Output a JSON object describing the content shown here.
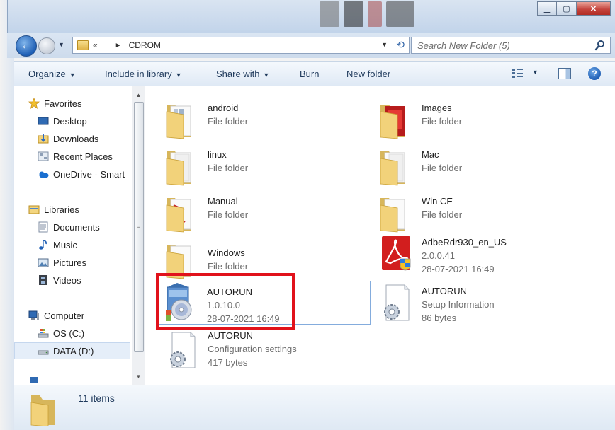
{
  "window": {
    "minimize": "▁",
    "maximize": "▢",
    "close": "✕"
  },
  "address": {
    "overflow": "«",
    "separator": "►",
    "current": "CDROM"
  },
  "search": {
    "placeholder": "Search New Folder (5)"
  },
  "toolbar": {
    "organize": "Organize",
    "include_in_library": "Include in library",
    "share_with": "Share with",
    "burn": "Burn",
    "new_folder": "New folder",
    "caret": "▼",
    "help": "?"
  },
  "nav": {
    "favorites": "Favorites",
    "desktop": "Desktop",
    "downloads": "Downloads",
    "recent_places": "Recent Places",
    "onedrive": "OneDrive - Smart",
    "libraries": "Libraries",
    "documents": "Documents",
    "music": "Music",
    "pictures": "Pictures",
    "videos": "Videos",
    "computer": "Computer",
    "os_c": "OS (C:)",
    "data_d": "DATA (D:)"
  },
  "files": [
    {
      "name": "android",
      "line2": "File folder",
      "line3": "",
      "icon": "folder-icon"
    },
    {
      "name": "Images",
      "line2": "File folder",
      "line3": "",
      "icon": "folder-icon"
    },
    {
      "name": "linux",
      "line2": "File folder",
      "line3": "",
      "icon": "folder-icon"
    },
    {
      "name": "Mac",
      "line2": "File folder",
      "line3": "",
      "icon": "folder-icon"
    },
    {
      "name": "Manual",
      "line2": "File folder",
      "line3": "",
      "icon": "folder-icon"
    },
    {
      "name": "Win CE",
      "line2": "File folder",
      "line3": "",
      "icon": "folder-icon"
    },
    {
      "name": "Windows",
      "line2": "File folder",
      "line3": "",
      "icon": "folder-icon"
    },
    {
      "name": "AdbeRdr930_en_US",
      "line2": "2.0.0.41",
      "line3": "28-07-2021 16:49",
      "icon": "adobe-reader-installer-icon"
    },
    {
      "name": "AUTORUN",
      "line2": "1.0.10.0",
      "line3": "28-07-2021 16:49",
      "icon": "autorun-exe-icon"
    },
    {
      "name": "AUTORUN",
      "line2": "Setup Information",
      "line3": "86 bytes",
      "icon": "setup-information-icon"
    },
    {
      "name": "AUTORUN",
      "line2": "Configuration settings",
      "line3": "417 bytes",
      "icon": "configuration-settings-icon"
    }
  ],
  "details": {
    "count": "11 items"
  }
}
